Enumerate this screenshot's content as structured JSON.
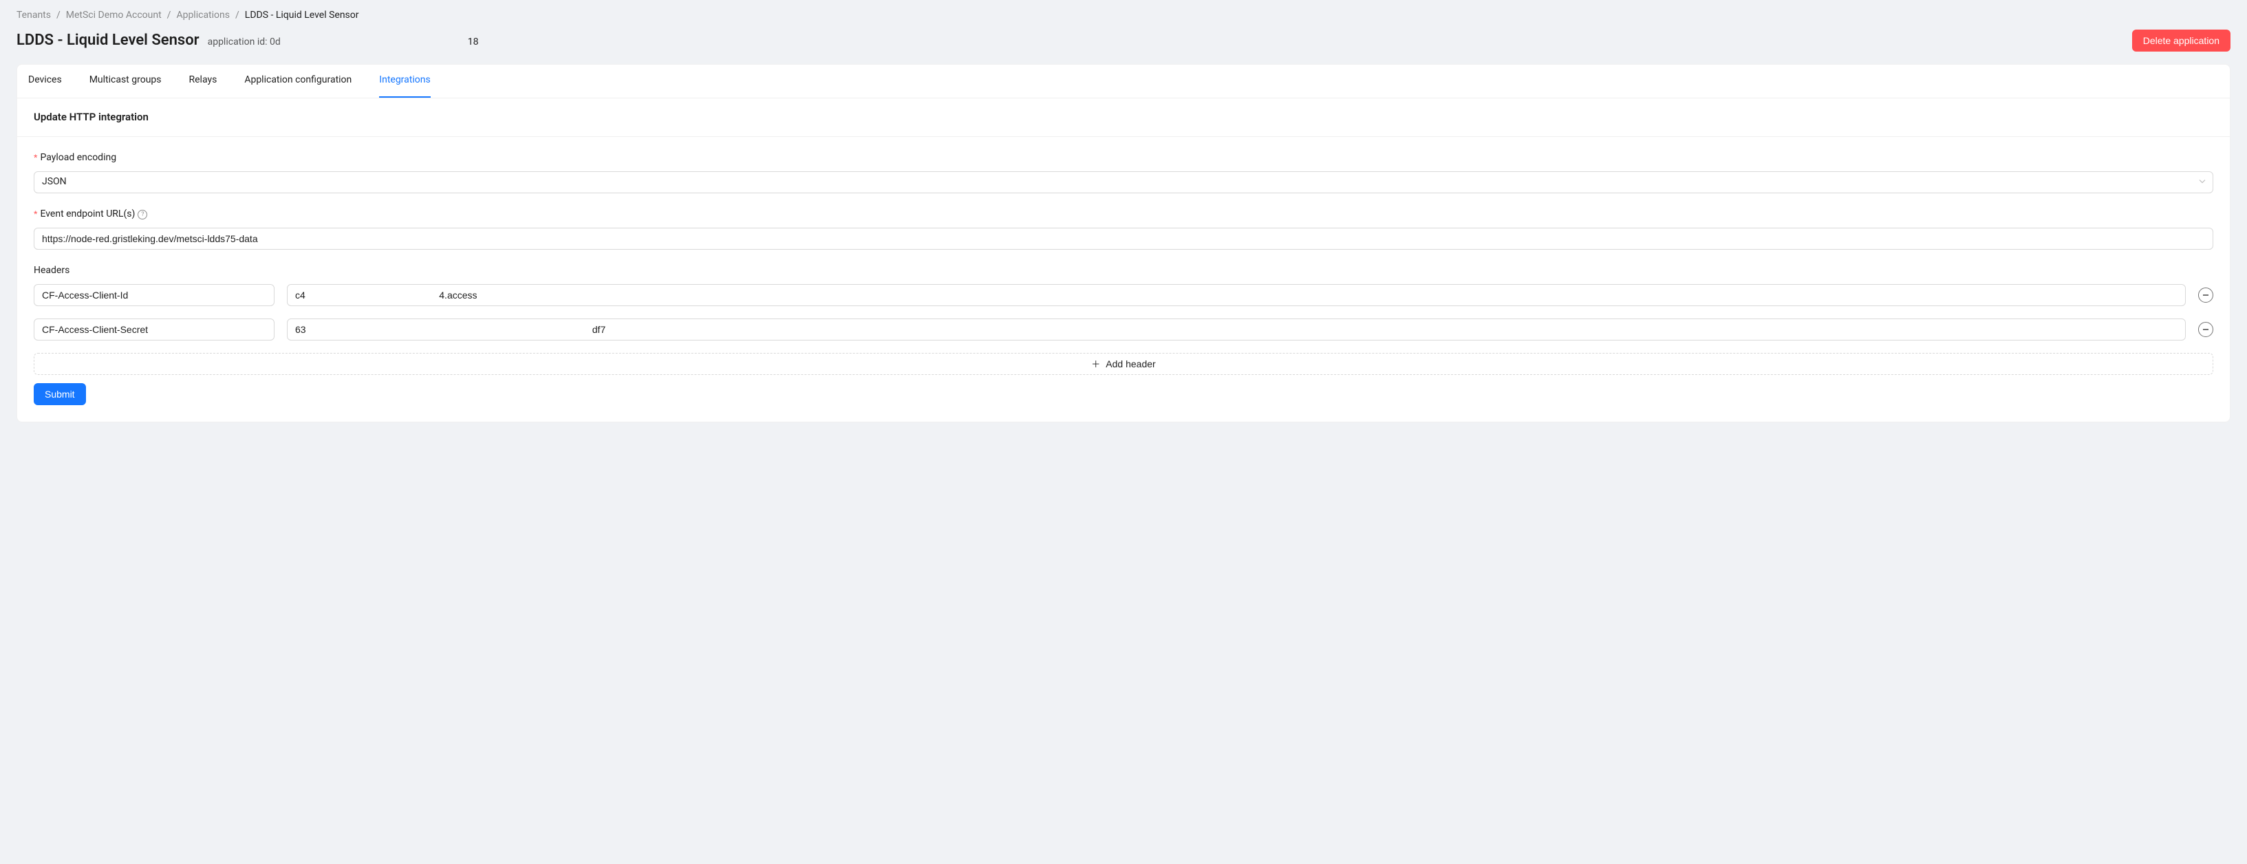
{
  "breadcrumb": {
    "items": [
      {
        "label": "Tenants"
      },
      {
        "label": "MetSci Demo Account"
      },
      {
        "label": "Applications"
      }
    ],
    "current": "LDDS - Liquid Level Sensor"
  },
  "header": {
    "title": "LDDS - Liquid Level Sensor",
    "subtitle": "application id: 0d",
    "extra_number": "18",
    "delete_label": "Delete application"
  },
  "tabs": [
    {
      "label": "Devices",
      "active": false
    },
    {
      "label": "Multicast groups",
      "active": false
    },
    {
      "label": "Relays",
      "active": false
    },
    {
      "label": "Application configuration",
      "active": false
    },
    {
      "label": "Integrations",
      "active": true
    }
  ],
  "section": {
    "title": "Update HTTP integration"
  },
  "form": {
    "payload_encoding": {
      "label": "Payload encoding",
      "value": "JSON"
    },
    "endpoint": {
      "label": "Event endpoint URL(s)",
      "value": "https://node-red.gristleking.dev/metsci-ldds75-data"
    },
    "headers_label": "Headers",
    "headers": [
      {
        "key": "CF-Access-Client-Id",
        "value": "c4                                                  4.access"
      },
      {
        "key": "CF-Access-Client-Secret",
        "value": "63                                                                                                           df7"
      }
    ],
    "add_header_label": "Add header",
    "submit_label": "Submit"
  }
}
